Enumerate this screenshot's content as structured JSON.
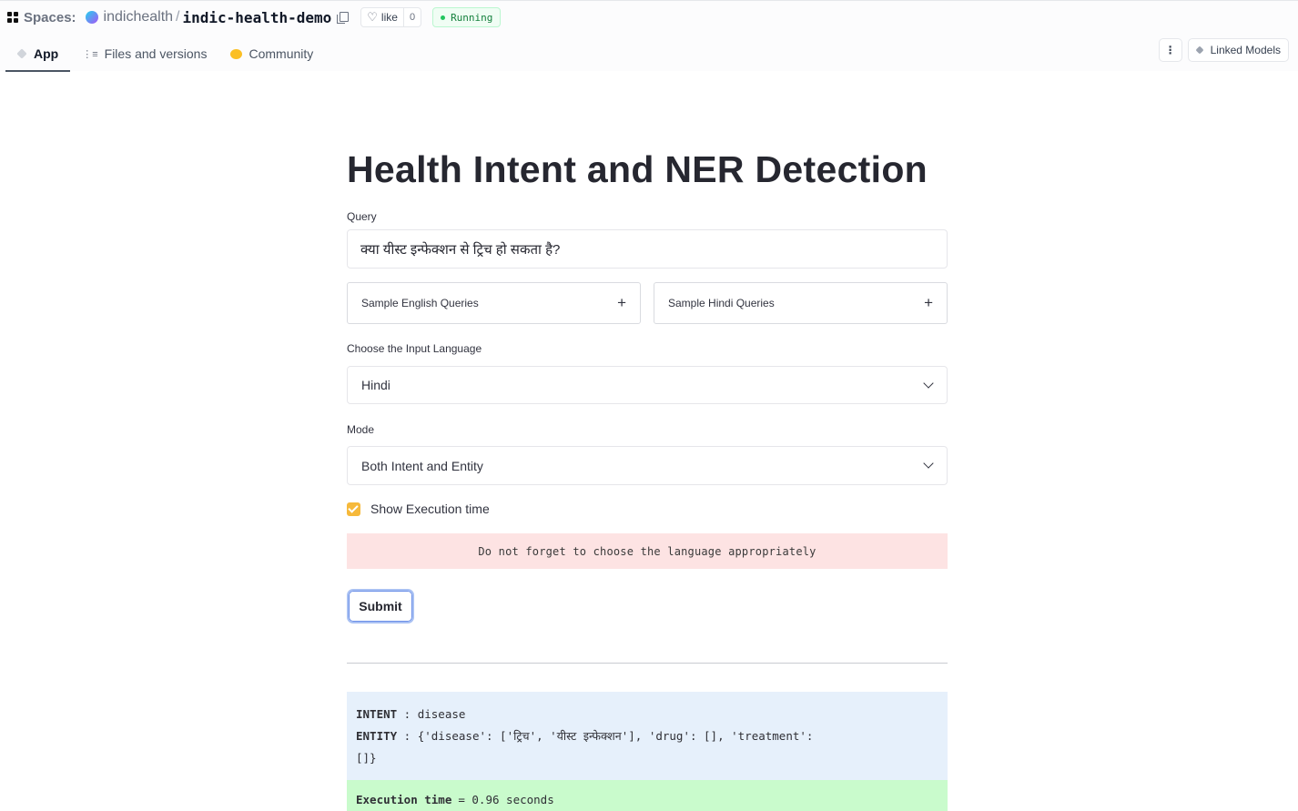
{
  "header": {
    "spaces_label": "Spaces:",
    "org": "indichealth",
    "separator": "/",
    "repo": "indic-health-demo",
    "like_label": "like",
    "like_count": "0",
    "status": "Running",
    "status_color": "#22c55e",
    "tabs": [
      {
        "label": "App",
        "icon": "cube-icon",
        "active": true
      },
      {
        "label": "Files and versions",
        "icon": "files-icon",
        "active": false
      },
      {
        "label": "Community",
        "icon": "community-icon",
        "active": false
      }
    ],
    "menu_icon": "kebab-menu-icon",
    "linked_models_label": "Linked Models"
  },
  "app": {
    "title": "Health Intent and NER Detection",
    "query_label": "Query",
    "query_value": "क्या यीस्ट इन्फेक्शन से ट्रिच हो सकता है?",
    "expanders": [
      {
        "label": "Sample English Queries",
        "icon": "plus-icon"
      },
      {
        "label": "Sample Hindi Queries",
        "icon": "plus-icon"
      }
    ],
    "language_label": "Choose the Input Language",
    "language_value": "Hindi",
    "mode_label": "Mode",
    "mode_value": "Both Intent and Entity",
    "show_time_label": "Show Execution time",
    "show_time_checked": true,
    "warning": "Do not forget to choose the language appropriately",
    "submit_label": "Submit",
    "accent_color": "#f6b93b"
  },
  "result": {
    "intent_key": "INTENT",
    "intent_sep": " : ",
    "intent_value": "disease",
    "entity_key": "ENTITY",
    "entity_sep": " : ",
    "entity_value_line1": "{'disease': ['ट्रिच', 'यीस्ट इन्फेक्शन'], 'drug': [], 'treatment':",
    "entity_value_line2": "[]}",
    "time_key": "Execution time",
    "time_value": "= 0.96 seconds"
  }
}
